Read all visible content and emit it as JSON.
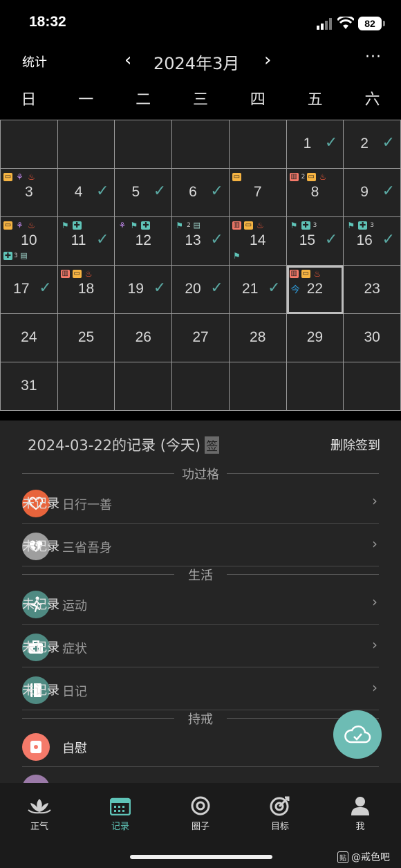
{
  "status_bar": {
    "time": "18:32",
    "battery": "82"
  },
  "nav": {
    "stats_label": "统计",
    "prev": "‹",
    "title": "2024年3月",
    "next": "›",
    "more": "···"
  },
  "weekdays": [
    "日",
    "一",
    "二",
    "三",
    "四",
    "五",
    "六"
  ],
  "calendar": {
    "days": [
      {
        "n": "",
        "check": false,
        "icons": []
      },
      {
        "n": "",
        "check": false,
        "icons": []
      },
      {
        "n": "",
        "check": false,
        "icons": []
      },
      {
        "n": "",
        "check": false,
        "icons": []
      },
      {
        "n": "",
        "check": false,
        "icons": []
      },
      {
        "n": "1",
        "check": true,
        "icons": []
      },
      {
        "n": "2",
        "check": true,
        "icons": []
      },
      {
        "n": "3",
        "check": false,
        "icons": [
          "tv",
          "yoga",
          "fire"
        ]
      },
      {
        "n": "4",
        "check": true,
        "icons": []
      },
      {
        "n": "5",
        "check": true,
        "icons": []
      },
      {
        "n": "6",
        "check": true,
        "icons": []
      },
      {
        "n": "7",
        "check": false,
        "icons": [
          "tv"
        ]
      },
      {
        "n": "8",
        "check": false,
        "icons": [
          "toilet",
          "2",
          "tv",
          "fire"
        ]
      },
      {
        "n": "9",
        "check": true,
        "icons": []
      },
      {
        "n": "10",
        "check": false,
        "icons": [
          "tv",
          "yoga",
          "fire"
        ],
        "bottom_icons": [
          "med",
          "3",
          "note"
        ]
      },
      {
        "n": "11",
        "check": true,
        "icons": [
          "run",
          "med"
        ]
      },
      {
        "n": "12",
        "check": false,
        "icons": [
          "yoga",
          "run",
          "med"
        ]
      },
      {
        "n": "13",
        "check": true,
        "icons": [
          "run",
          "2",
          "note"
        ]
      },
      {
        "n": "14",
        "check": false,
        "icons": [
          "toilet",
          "tv",
          "fire"
        ],
        "bottom_icons": [
          "run"
        ]
      },
      {
        "n": "15",
        "check": true,
        "icons": [
          "run",
          "med",
          "3"
        ]
      },
      {
        "n": "16",
        "check": true,
        "icons": [
          "run",
          "med",
          "3"
        ]
      },
      {
        "n": "17",
        "check": true,
        "icons": []
      },
      {
        "n": "18",
        "check": false,
        "icons": [
          "toilet",
          "tv",
          "fire"
        ]
      },
      {
        "n": "19",
        "check": true,
        "icons": []
      },
      {
        "n": "20",
        "check": true,
        "icons": []
      },
      {
        "n": "21",
        "check": true,
        "icons": []
      },
      {
        "n": "22",
        "check": false,
        "icons": [
          "toilet",
          "tv",
          "fire"
        ],
        "today": true,
        "today_label": "今"
      },
      {
        "n": "23",
        "check": false,
        "icons": []
      },
      {
        "n": "24",
        "check": false,
        "icons": []
      },
      {
        "n": "25",
        "check": false,
        "icons": []
      },
      {
        "n": "26",
        "check": false,
        "icons": []
      },
      {
        "n": "27",
        "check": false,
        "icons": []
      },
      {
        "n": "28",
        "check": false,
        "icons": []
      },
      {
        "n": "29",
        "check": false,
        "icons": []
      },
      {
        "n": "30",
        "check": false,
        "icons": []
      },
      {
        "n": "31",
        "check": false,
        "icons": []
      },
      {
        "n": "",
        "check": false,
        "icons": []
      },
      {
        "n": "",
        "check": false,
        "icons": []
      },
      {
        "n": "",
        "check": false,
        "icons": []
      },
      {
        "n": "",
        "check": false,
        "icons": []
      },
      {
        "n": "",
        "check": false,
        "icons": []
      },
      {
        "n": "",
        "check": false,
        "icons": []
      }
    ]
  },
  "records": {
    "title": "2024-03-22的记录 (今天)",
    "sign_badge": "签",
    "delete_label": "删除签到",
    "sections": {
      "merit": "功过格",
      "life": "生活",
      "precepts": "持戒"
    },
    "items": [
      {
        "label": "日行一善",
        "status": "未记录",
        "color": "#e8643c"
      },
      {
        "label": "三省吾身",
        "status": "未记录",
        "color": "#9e9e9e"
      },
      {
        "label": "运动",
        "status": "未记录",
        "color": "#4f8a82"
      },
      {
        "label": "症状",
        "status": "未记录",
        "color": "#4f8a82"
      },
      {
        "label": "日记",
        "status": "未记录",
        "color": "#4f8a82"
      },
      {
        "label": "自慰",
        "status": "",
        "color": "#f57a6a"
      }
    ]
  },
  "tabs": [
    {
      "label": "正气",
      "icon": "lotus-icon"
    },
    {
      "label": "记录",
      "icon": "calendar-icon"
    },
    {
      "label": "圈子",
      "icon": "circle-icon"
    },
    {
      "label": "目标",
      "icon": "target-icon"
    },
    {
      "label": "我",
      "icon": "person-icon"
    }
  ],
  "watermark": {
    "badge": "贴",
    "text": "@戒色吧"
  }
}
